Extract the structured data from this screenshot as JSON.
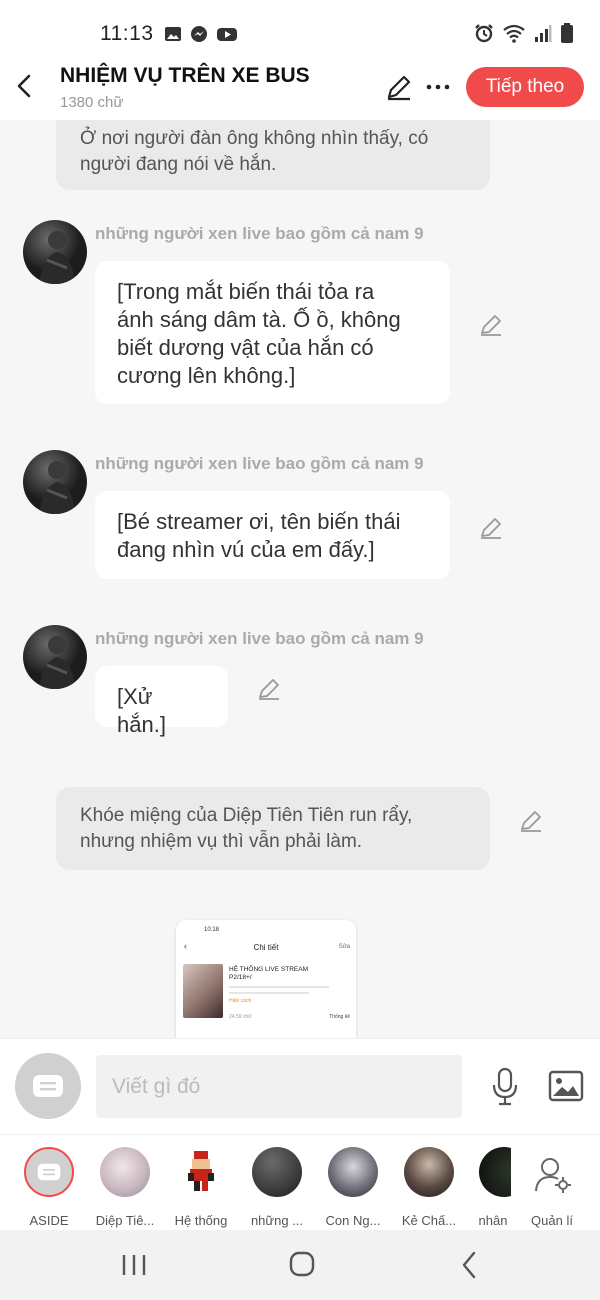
{
  "status_bar": {
    "time": "11:13",
    "left_icons": [
      "gallery-icon",
      "messenger-icon",
      "youtube-icon"
    ],
    "right_icons": [
      "alarm-icon",
      "wifi-icon",
      "signal-icon",
      "battery-icon"
    ]
  },
  "header": {
    "title": "NHIỆM VỤ TRÊN XE BUS",
    "word_count": "1380 chữ",
    "next_label": "Tiếp theo",
    "accent_color": "#f14a4a"
  },
  "chat": {
    "top_narration": "Ở nơi người đàn ông không nhìn thấy, có\nngười đang nói về hắn.",
    "messages": [
      {
        "sender": "những người xen live bao gồm cả nam 9",
        "text": "[Trong mắt biến thái tỏa ra\nánh sáng dâm tà. Ố ồ, không\nbiết dương vật của hắn có\ncương lên không.]"
      },
      {
        "sender": "những người xen live bao gồm cả nam 9",
        "text": "[Bé streamer ơi, tên biến thái\nđang nhìn vú của em đấy.]"
      },
      {
        "sender": "những người xen live bao gồm cả nam 9",
        "text": "[Xử hắn.]"
      }
    ],
    "narration": "Khóe miệng của Diệp Tiên Tiên run rẩy,\nnhưng nhiệm vụ thì vẫn phải làm.",
    "image_preview": {
      "time": "10:18",
      "heading": "Chi tiết",
      "edit": "Sửa",
      "story_title": "HỆ THỐNG LIVE STREAM\nP2/18+/",
      "tag": "Hiện cách",
      "count": "24.59 chữ",
      "stats": "Thống kê"
    }
  },
  "input": {
    "placeholder": "Viết gì đó"
  },
  "characters": [
    {
      "label": "ASIDE",
      "selected": true
    },
    {
      "label": "Diệp Tiê..."
    },
    {
      "label": "Hệ thống"
    },
    {
      "label": "những ..."
    },
    {
      "label": "Con Ng..."
    },
    {
      "label": "Kẻ Chấ..."
    },
    {
      "label": "nhân"
    },
    {
      "label": "Quản lí"
    }
  ]
}
